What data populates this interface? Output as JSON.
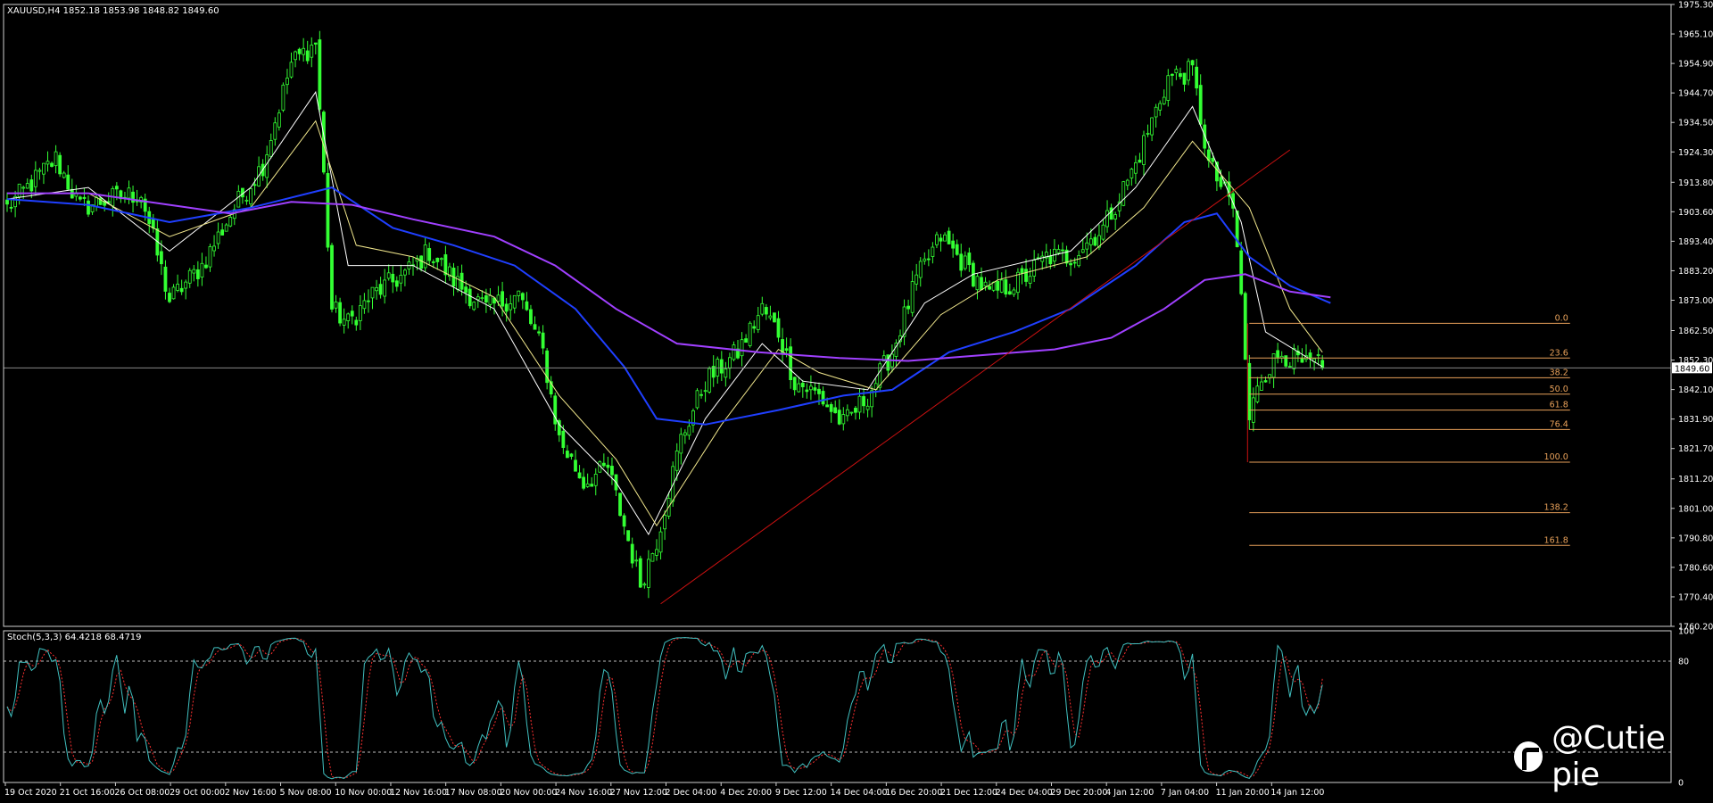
{
  "header": {
    "symbol_line": "XAUUSD,H4  1852.18 1853.98 1848.82 1849.60",
    "stoch_line": "Stoch(5,3,3) 64.4218 68.4719"
  },
  "colors": {
    "background": "#000000",
    "candle": "#33ff33",
    "ma_fast": "#ffffff",
    "ma_slow": "#f0e68c",
    "ma_blue": "#1f3fff",
    "ma_purple": "#a040ff",
    "trendline": "#cc1111",
    "fib": "#e8a15a",
    "stoch_main": "#40c0c0",
    "stoch_signal": "#ff3030",
    "frame": "#cfcfcf"
  },
  "watermark": {
    "text": "@Cutie pie",
    "icon": "brand-logo-icon"
  },
  "chart_data": {
    "type": "candlestick",
    "symbol": "XAUUSD",
    "timeframe": "H4",
    "ohlc_last": {
      "open": 1852.18,
      "high": 1853.98,
      "low": 1848.82,
      "close": 1849.6
    },
    "current_price_label": "1849.60",
    "ylim": [
      1760.2,
      1975.3
    ],
    "y_ticks": [
      "1975.30",
      "1965.10",
      "1954.90",
      "1944.70",
      "1934.50",
      "1924.30",
      "1913.80",
      "1903.60",
      "1893.40",
      "1883.20",
      "1873.00",
      "1862.50",
      "1852.30",
      "1842.10",
      "1831.90",
      "1821.70",
      "1811.20",
      "1801.00",
      "1790.80",
      "1780.60",
      "1770.40",
      "1760.20"
    ],
    "x_ticks": [
      "19 Oct 2020",
      "21 Oct 16:00",
      "26 Oct 08:00",
      "29 Oct 00:00",
      "2 Nov 16:00",
      "5 Nov 08:00",
      "10 Nov 00:00",
      "12 Nov 16:00",
      "17 Nov 08:00",
      "20 Nov 00:00",
      "24 Nov 16:00",
      "27 Nov 12:00",
      "2 Dec 04:00",
      "4 Dec 20:00",
      "9 Dec 12:00",
      "14 Dec 04:00",
      "16 Dec 20:00",
      "21 Dec 12:00",
      "24 Dec 04:00",
      "29 Dec 20:00",
      "4 Jan 12:00",
      "7 Jan 04:00",
      "11 Jan 20:00",
      "14 Jan 12:00"
    ],
    "price_path": [
      [
        0,
        1905
      ],
      [
        5,
        1912
      ],
      [
        12,
        1922
      ],
      [
        18,
        1905
      ],
      [
        25,
        1908
      ],
      [
        33,
        1910
      ],
      [
        40,
        1873
      ],
      [
        48,
        1885
      ],
      [
        56,
        1905
      ],
      [
        63,
        1920
      ],
      [
        70,
        1955
      ],
      [
        76,
        1962
      ],
      [
        80,
        1870
      ],
      [
        84,
        1865
      ],
      [
        90,
        1875
      ],
      [
        98,
        1882
      ],
      [
        104,
        1890
      ],
      [
        110,
        1880
      ],
      [
        118,
        1870
      ],
      [
        126,
        1875
      ],
      [
        132,
        1855
      ],
      [
        136,
        1825
      ],
      [
        142,
        1810
      ],
      [
        148,
        1815
      ],
      [
        152,
        1795
      ],
      [
        156,
        1775
      ],
      [
        160,
        1790
      ],
      [
        166,
        1825
      ],
      [
        172,
        1845
      ],
      [
        180,
        1855
      ],
      [
        186,
        1870
      ],
      [
        190,
        1862
      ],
      [
        194,
        1845
      ],
      [
        200,
        1840
      ],
      [
        206,
        1830
      ],
      [
        212,
        1840
      ],
      [
        218,
        1855
      ],
      [
        224,
        1880
      ],
      [
        230,
        1895
      ],
      [
        236,
        1885
      ],
      [
        242,
        1875
      ],
      [
        250,
        1880
      ],
      [
        256,
        1888
      ],
      [
        262,
        1888
      ],
      [
        270,
        1898
      ],
      [
        278,
        1920
      ],
      [
        286,
        1950
      ],
      [
        292,
        1952
      ],
      [
        296,
        1920
      ],
      [
        302,
        1905
      ],
      [
        304,
        1875
      ],
      [
        306,
        1830
      ],
      [
        308,
        1845
      ],
      [
        314,
        1855
      ],
      [
        320,
        1850
      ],
      [
        324,
        1852
      ]
    ],
    "candle_count": 325,
    "moving_averages": [
      {
        "name": "MA fast",
        "color": "#ffffff",
        "points": [
          [
            0,
            1908
          ],
          [
            20,
            1912
          ],
          [
            40,
            1890
          ],
          [
            60,
            1912
          ],
          [
            76,
            1945
          ],
          [
            84,
            1885
          ],
          [
            100,
            1885
          ],
          [
            120,
            1870
          ],
          [
            136,
            1830
          ],
          [
            150,
            1810
          ],
          [
            158,
            1792
          ],
          [
            172,
            1832
          ],
          [
            186,
            1858
          ],
          [
            196,
            1845
          ],
          [
            212,
            1842
          ],
          [
            226,
            1872
          ],
          [
            238,
            1882
          ],
          [
            262,
            1890
          ],
          [
            278,
            1912
          ],
          [
            292,
            1940
          ],
          [
            304,
            1900
          ],
          [
            310,
            1862
          ],
          [
            324,
            1850
          ]
        ]
      },
      {
        "name": "MA slow",
        "color": "#f0e68c",
        "points": [
          [
            0,
            1910
          ],
          [
            20,
            1910
          ],
          [
            40,
            1895
          ],
          [
            60,
            1905
          ],
          [
            76,
            1935
          ],
          [
            86,
            1892
          ],
          [
            100,
            1888
          ],
          [
            120,
            1874
          ],
          [
            136,
            1840
          ],
          [
            150,
            1818
          ],
          [
            160,
            1795
          ],
          [
            176,
            1830
          ],
          [
            190,
            1856
          ],
          [
            200,
            1848
          ],
          [
            214,
            1842
          ],
          [
            230,
            1868
          ],
          [
            244,
            1880
          ],
          [
            266,
            1888
          ],
          [
            280,
            1905
          ],
          [
            292,
            1928
          ],
          [
            306,
            1905
          ],
          [
            316,
            1870
          ],
          [
            324,
            1855
          ]
        ]
      },
      {
        "name": "MA blue",
        "color": "#1f3fff",
        "points": [
          [
            0,
            1908
          ],
          [
            20,
            1906
          ],
          [
            40,
            1900
          ],
          [
            60,
            1905
          ],
          [
            80,
            1912
          ],
          [
            95,
            1898
          ],
          [
            110,
            1892
          ],
          [
            125,
            1885
          ],
          [
            140,
            1870
          ],
          [
            152,
            1850
          ],
          [
            160,
            1832
          ],
          [
            172,
            1830
          ],
          [
            190,
            1835
          ],
          [
            206,
            1840
          ],
          [
            218,
            1842
          ],
          [
            232,
            1855
          ],
          [
            248,
            1862
          ],
          [
            262,
            1870
          ],
          [
            278,
            1885
          ],
          [
            290,
            1900
          ],
          [
            298,
            1903
          ],
          [
            306,
            1888
          ],
          [
            316,
            1878
          ],
          [
            326,
            1872
          ]
        ]
      },
      {
        "name": "MA purple",
        "color": "#a040ff",
        "points": [
          [
            0,
            1910
          ],
          [
            20,
            1910
          ],
          [
            40,
            1906
          ],
          [
            55,
            1903
          ],
          [
            70,
            1907
          ],
          [
            85,
            1906
          ],
          [
            100,
            1901
          ],
          [
            120,
            1895
          ],
          [
            135,
            1885
          ],
          [
            150,
            1870
          ],
          [
            165,
            1858
          ],
          [
            185,
            1855
          ],
          [
            205,
            1853
          ],
          [
            222,
            1852
          ],
          [
            240,
            1854
          ],
          [
            258,
            1856
          ],
          [
            272,
            1860
          ],
          [
            285,
            1870
          ],
          [
            295,
            1880
          ],
          [
            305,
            1882
          ],
          [
            316,
            1876
          ],
          [
            326,
            1874
          ]
        ]
      }
    ],
    "trendline": {
      "color": "#cc1111",
      "from": [
        161,
        1768
      ],
      "to": [
        316,
        1925
      ]
    },
    "fibonacci": {
      "start_bar": 306,
      "end_bar": 385,
      "levels": [
        {
          "label": "0.0",
          "price": 1865.0
        },
        {
          "label": "23.6",
          "price": 1853.0
        },
        {
          "label": "38.2",
          "price": 1846.2
        },
        {
          "label": "50.0",
          "price": 1840.5
        },
        {
          "label": "61.8",
          "price": 1835.0
        },
        {
          "label": "76.4",
          "price": 1828.3
        },
        {
          "label": "100.0",
          "price": 1817.0
        },
        {
          "label": "138.2",
          "price": 1799.5
        },
        {
          "label": "161.8",
          "price": 1788.2
        }
      ]
    },
    "stochastic": {
      "name": "Stoch(5,3,3)",
      "main": 64.4218,
      "signal": 68.4719,
      "ylim": [
        0,
        100
      ],
      "y_ticks": [
        "100",
        "80",
        "0"
      ],
      "levels": [
        80,
        20
      ]
    }
  }
}
